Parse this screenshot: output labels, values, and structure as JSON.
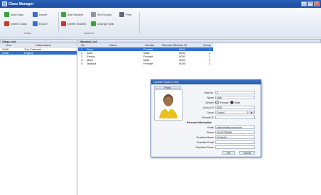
{
  "window": {
    "title": "Class Manager"
  },
  "toolbar": {
    "add_class": "Add Class",
    "import": "Import",
    "add_student": "Add Student",
    "set_groups": "Set Groups",
    "print": "Print",
    "delete_class": "Delete Class",
    "export": "Export",
    "delete_student": "Delete Student",
    "change_seat": "Change Seat",
    "group_class": "Class",
    "group_student": "Student"
  },
  "class_list": {
    "title": "Class List",
    "columns": [
      "Year",
      "Class Name"
    ],
    "rows": [
      {
        "year": "2008",
        "name": "The Coleman",
        "selected": false
      },
      {
        "year": "2008",
        "name": "English",
        "selected": true
      }
    ]
  },
  "student_list": {
    "title": "Student List",
    "columns": [
      "No.",
      "Name",
      "Gender",
      "Remote ID",
      "School ID",
      "Group"
    ],
    "rows": [
      {
        "no": "1",
        "name": "Rose",
        "gender": "Female",
        "remote": "",
        "school": "0001",
        "group": "1",
        "selected": true
      },
      {
        "no": "2",
        "name": "Jack",
        "gender": "Male",
        "remote": "",
        "school": "0002",
        "group": "1",
        "selected": false
      },
      {
        "no": "3",
        "name": "Emma",
        "gender": "Female",
        "remote": "",
        "school": "0003",
        "group": "1",
        "selected": false
      },
      {
        "no": "4",
        "name": "Mark",
        "gender": "Male",
        "remote": "",
        "school": "0004",
        "group": "1",
        "selected": false
      },
      {
        "no": "5",
        "name": "Jessica",
        "gender": "Female",
        "remote": "",
        "school": "0005",
        "group": "1",
        "selected": false
      }
    ]
  },
  "dialog": {
    "title": "Update Student Info",
    "photo_label": "Photo",
    "seat_no_label": "Seat No.",
    "seat_no_value": "2",
    "name_label": "Name",
    "name_value": "Jack",
    "gender_label": "Gender",
    "gender_female": "Female",
    "gender_male": "Male",
    "school_id_label": "School ID",
    "school_id_value": "0002",
    "group_label": "Group",
    "group_value": "Group1",
    "remote_id_label": "Remote ID",
    "remote_id_value": "",
    "personal_info_label": "Personal Information",
    "email_label": "Email",
    "email_value": "jackmith@anymail.com",
    "phone_label": "Phone",
    "phone_value": "00162789456",
    "guardian_name_label": "Guardian Name",
    "guardian_name_value": "Mr.Smith",
    "guardian_email_label": "Guardian Email",
    "guardian_email_value": "",
    "guardian_phone_label": "Guardian Phone",
    "guardian_phone_value": "",
    "ok": "OK",
    "cancel": "Cancel"
  }
}
